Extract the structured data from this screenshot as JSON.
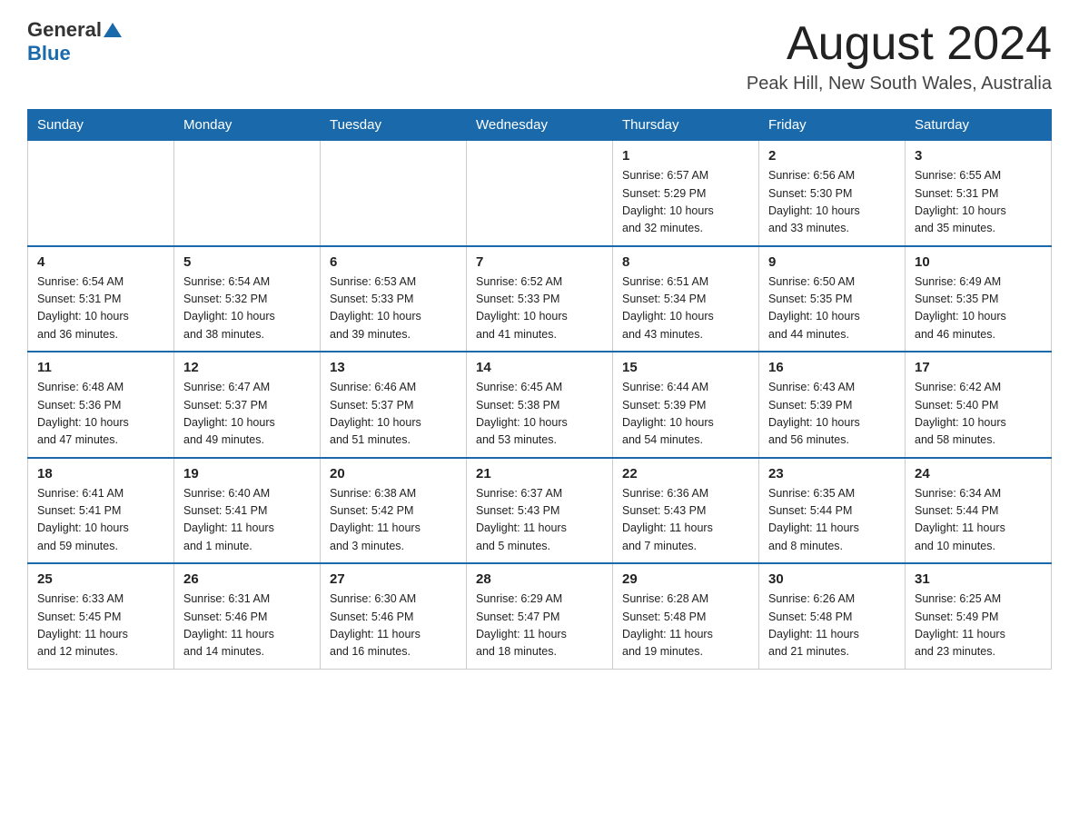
{
  "header": {
    "logo_general": "General",
    "logo_blue": "Blue",
    "month_title": "August 2024",
    "location": "Peak Hill, New South Wales, Australia"
  },
  "days_of_week": [
    "Sunday",
    "Monday",
    "Tuesday",
    "Wednesday",
    "Thursday",
    "Friday",
    "Saturday"
  ],
  "weeks": [
    {
      "days": [
        {
          "number": "",
          "info": ""
        },
        {
          "number": "",
          "info": ""
        },
        {
          "number": "",
          "info": ""
        },
        {
          "number": "",
          "info": ""
        },
        {
          "number": "1",
          "info": "Sunrise: 6:57 AM\nSunset: 5:29 PM\nDaylight: 10 hours\nand 32 minutes."
        },
        {
          "number": "2",
          "info": "Sunrise: 6:56 AM\nSunset: 5:30 PM\nDaylight: 10 hours\nand 33 minutes."
        },
        {
          "number": "3",
          "info": "Sunrise: 6:55 AM\nSunset: 5:31 PM\nDaylight: 10 hours\nand 35 minutes."
        }
      ]
    },
    {
      "days": [
        {
          "number": "4",
          "info": "Sunrise: 6:54 AM\nSunset: 5:31 PM\nDaylight: 10 hours\nand 36 minutes."
        },
        {
          "number": "5",
          "info": "Sunrise: 6:54 AM\nSunset: 5:32 PM\nDaylight: 10 hours\nand 38 minutes."
        },
        {
          "number": "6",
          "info": "Sunrise: 6:53 AM\nSunset: 5:33 PM\nDaylight: 10 hours\nand 39 minutes."
        },
        {
          "number": "7",
          "info": "Sunrise: 6:52 AM\nSunset: 5:33 PM\nDaylight: 10 hours\nand 41 minutes."
        },
        {
          "number": "8",
          "info": "Sunrise: 6:51 AM\nSunset: 5:34 PM\nDaylight: 10 hours\nand 43 minutes."
        },
        {
          "number": "9",
          "info": "Sunrise: 6:50 AM\nSunset: 5:35 PM\nDaylight: 10 hours\nand 44 minutes."
        },
        {
          "number": "10",
          "info": "Sunrise: 6:49 AM\nSunset: 5:35 PM\nDaylight: 10 hours\nand 46 minutes."
        }
      ]
    },
    {
      "days": [
        {
          "number": "11",
          "info": "Sunrise: 6:48 AM\nSunset: 5:36 PM\nDaylight: 10 hours\nand 47 minutes."
        },
        {
          "number": "12",
          "info": "Sunrise: 6:47 AM\nSunset: 5:37 PM\nDaylight: 10 hours\nand 49 minutes."
        },
        {
          "number": "13",
          "info": "Sunrise: 6:46 AM\nSunset: 5:37 PM\nDaylight: 10 hours\nand 51 minutes."
        },
        {
          "number": "14",
          "info": "Sunrise: 6:45 AM\nSunset: 5:38 PM\nDaylight: 10 hours\nand 53 minutes."
        },
        {
          "number": "15",
          "info": "Sunrise: 6:44 AM\nSunset: 5:39 PM\nDaylight: 10 hours\nand 54 minutes."
        },
        {
          "number": "16",
          "info": "Sunrise: 6:43 AM\nSunset: 5:39 PM\nDaylight: 10 hours\nand 56 minutes."
        },
        {
          "number": "17",
          "info": "Sunrise: 6:42 AM\nSunset: 5:40 PM\nDaylight: 10 hours\nand 58 minutes."
        }
      ]
    },
    {
      "days": [
        {
          "number": "18",
          "info": "Sunrise: 6:41 AM\nSunset: 5:41 PM\nDaylight: 10 hours\nand 59 minutes."
        },
        {
          "number": "19",
          "info": "Sunrise: 6:40 AM\nSunset: 5:41 PM\nDaylight: 11 hours\nand 1 minute."
        },
        {
          "number": "20",
          "info": "Sunrise: 6:38 AM\nSunset: 5:42 PM\nDaylight: 11 hours\nand 3 minutes."
        },
        {
          "number": "21",
          "info": "Sunrise: 6:37 AM\nSunset: 5:43 PM\nDaylight: 11 hours\nand 5 minutes."
        },
        {
          "number": "22",
          "info": "Sunrise: 6:36 AM\nSunset: 5:43 PM\nDaylight: 11 hours\nand 7 minutes."
        },
        {
          "number": "23",
          "info": "Sunrise: 6:35 AM\nSunset: 5:44 PM\nDaylight: 11 hours\nand 8 minutes."
        },
        {
          "number": "24",
          "info": "Sunrise: 6:34 AM\nSunset: 5:44 PM\nDaylight: 11 hours\nand 10 minutes."
        }
      ]
    },
    {
      "days": [
        {
          "number": "25",
          "info": "Sunrise: 6:33 AM\nSunset: 5:45 PM\nDaylight: 11 hours\nand 12 minutes."
        },
        {
          "number": "26",
          "info": "Sunrise: 6:31 AM\nSunset: 5:46 PM\nDaylight: 11 hours\nand 14 minutes."
        },
        {
          "number": "27",
          "info": "Sunrise: 6:30 AM\nSunset: 5:46 PM\nDaylight: 11 hours\nand 16 minutes."
        },
        {
          "number": "28",
          "info": "Sunrise: 6:29 AM\nSunset: 5:47 PM\nDaylight: 11 hours\nand 18 minutes."
        },
        {
          "number": "29",
          "info": "Sunrise: 6:28 AM\nSunset: 5:48 PM\nDaylight: 11 hours\nand 19 minutes."
        },
        {
          "number": "30",
          "info": "Sunrise: 6:26 AM\nSunset: 5:48 PM\nDaylight: 11 hours\nand 21 minutes."
        },
        {
          "number": "31",
          "info": "Sunrise: 6:25 AM\nSunset: 5:49 PM\nDaylight: 11 hours\nand 23 minutes."
        }
      ]
    }
  ]
}
